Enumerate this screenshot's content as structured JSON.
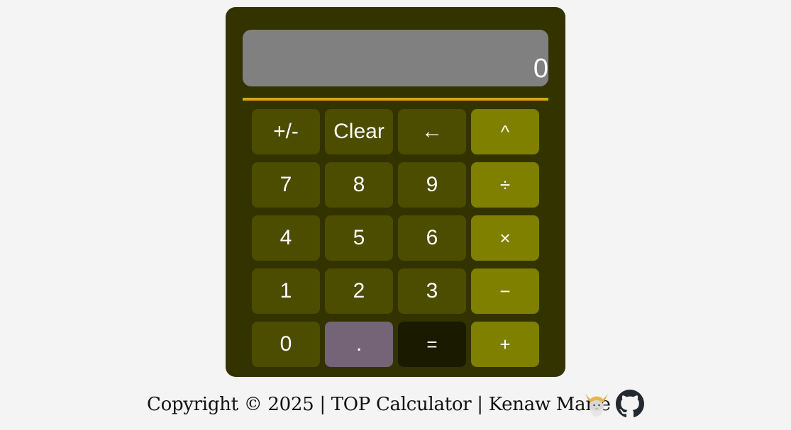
{
  "display": {
    "value": "0"
  },
  "keypad": {
    "keys": [
      {
        "label": "+/-",
        "name": "sign-toggle-button",
        "kind": "func"
      },
      {
        "label": "Clear",
        "name": "clear-button",
        "kind": "func"
      },
      {
        "label": "←",
        "name": "backspace-button",
        "kind": "func"
      },
      {
        "label": "^",
        "name": "power-button",
        "kind": "op"
      },
      {
        "label": "7",
        "name": "digit-7-button",
        "kind": "digit"
      },
      {
        "label": "8",
        "name": "digit-8-button",
        "kind": "digit"
      },
      {
        "label": "9",
        "name": "digit-9-button",
        "kind": "digit"
      },
      {
        "label": "÷",
        "name": "divide-button",
        "kind": "op"
      },
      {
        "label": "4",
        "name": "digit-4-button",
        "kind": "digit"
      },
      {
        "label": "5",
        "name": "digit-5-button",
        "kind": "digit"
      },
      {
        "label": "6",
        "name": "digit-6-button",
        "kind": "digit"
      },
      {
        "label": "×",
        "name": "multiply-button",
        "kind": "op"
      },
      {
        "label": "1",
        "name": "digit-1-button",
        "kind": "digit"
      },
      {
        "label": "2",
        "name": "digit-2-button",
        "kind": "digit"
      },
      {
        "label": "3",
        "name": "digit-3-button",
        "kind": "digit"
      },
      {
        "label": "−",
        "name": "subtract-button",
        "kind": "op"
      },
      {
        "label": "0",
        "name": "digit-0-button",
        "kind": "digit"
      },
      {
        "label": ".",
        "name": "decimal-button",
        "kind": "decimal"
      },
      {
        "label": "=",
        "name": "equals-button",
        "kind": "equals"
      },
      {
        "label": "+",
        "name": "add-button",
        "kind": "op"
      }
    ]
  },
  "footer": {
    "copyright": "Copyright © 2025",
    "separator": " | ",
    "project": "TOP Calculator",
    "author": "Kenaw Marie",
    "icons": [
      "odin-project-icon",
      "github-icon"
    ]
  },
  "colors": {
    "body_bg": "#f4f4f4",
    "calculator_bg": "#333300",
    "display_bg": "#808080",
    "divider": "#d9a514",
    "digit_key": "#4d4d00",
    "operator_key": "#808000",
    "decimal_key": "#756478",
    "equals_key": "#1a1a00"
  }
}
